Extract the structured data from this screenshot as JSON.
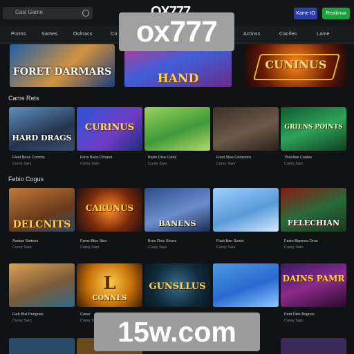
{
  "header": {
    "search_placeholder": "Casi Game",
    "brand": "OX777",
    "login_label": "Kame tO",
    "register_label": "Realitnua"
  },
  "nav": [
    "Porms",
    "Sames",
    "Oolnacs",
    "Co",
    "Actinss",
    "Cacifes",
    "Lame"
  ],
  "watermark_top": "ox777",
  "watermark_bottom": "15w.com",
  "banners": [
    {
      "title": "FORET DARMARS"
    },
    {
      "title": "HAND PACTURR"
    },
    {
      "title": "CUNINUS"
    }
  ],
  "sections": [
    {
      "title": "Cams Rets",
      "cards": [
        {
          "art": "HARD DRAGS",
          "caption": "Flent Bous Comms",
          "sub": "Curey Sars"
        },
        {
          "art": "CURINUS",
          "caption": "Fiero Baos Omaroi",
          "sub": "Curey Sars"
        },
        {
          "art": "",
          "caption": "Barm Disa Conis",
          "sub": "Curey Sars"
        },
        {
          "art": "",
          "caption": "Fionl Stae Conkoore",
          "sub": "Curey Sars"
        },
        {
          "art": "GRIENS POINTS",
          "caption": "Thal Ase Conies",
          "sub": "Curey Sars"
        }
      ]
    },
    {
      "title": "Febio Cogus",
      "cards": [
        {
          "art": "DELCNITS",
          "caption": "Aastae Stetnes",
          "sub": "Curey Sars"
        },
        {
          "art": "CARUNUS",
          "caption": "Fams Blue Stes",
          "sub": "Curey Sars"
        },
        {
          "art": "BANENS",
          "caption": "Broo Dies Sinsrs",
          "sub": "Curey Sars"
        },
        {
          "art": "",
          "caption": "Flast Ban Soieis",
          "sub": "Curey Sars"
        },
        {
          "art": "FELECHIAN",
          "caption": "Faste Biasnea Orus",
          "sub": "Curey Sars"
        }
      ]
    },
    {
      "title": "",
      "cards": [
        {
          "art": "",
          "caption": "Fieh Blst Perignes",
          "sub": "Curey Sars"
        },
        {
          "art": "CONNES",
          "caption": "Coner",
          "sub": "Curey Sars"
        },
        {
          "art": "GUNSLLUS",
          "caption": "",
          "sub": ""
        },
        {
          "art": "",
          "caption": "",
          "sub": ""
        },
        {
          "art": "DAINS PAMR",
          "caption": "Pent Diek Bsgnos",
          "sub": "Curey Sars"
        }
      ]
    }
  ],
  "colors": {
    "login": "#2a3ea8",
    "register": "#17a33a",
    "background": "#111214"
  }
}
